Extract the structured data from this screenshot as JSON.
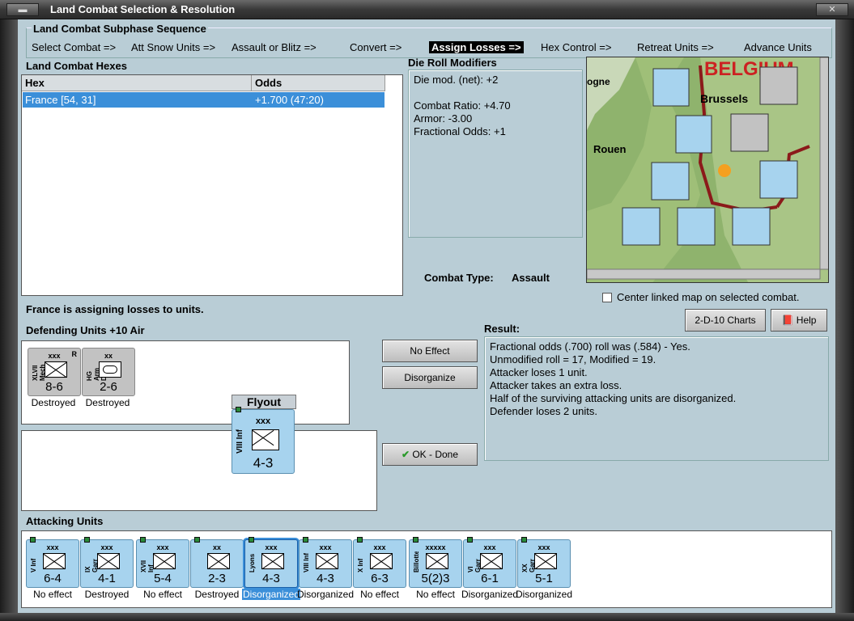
{
  "window": {
    "title": "Land Combat Selection & Resolution"
  },
  "sequence": {
    "legend": "Land Combat Subphase Sequence",
    "steps": [
      {
        "label": "Select Combat =>",
        "active": false
      },
      {
        "label": "Att Snow Units =>",
        "active": false
      },
      {
        "label": "Assault or Blitz =>",
        "active": false
      },
      {
        "label": "Convert =>",
        "active": false
      },
      {
        "label": "Assign Losses =>",
        "active": true
      },
      {
        "label": "Hex Control =>",
        "active": false
      },
      {
        "label": "Retreat Units =>",
        "active": false
      },
      {
        "label": "Advance Units",
        "active": false
      }
    ]
  },
  "hexes": {
    "title": "Land Combat Hexes",
    "columns": [
      "Hex",
      "Odds"
    ],
    "rows": [
      {
        "hex": "France [54, 31]",
        "odds": "+1.700 (47:20)"
      }
    ]
  },
  "modifiers": {
    "title": "Die Roll Modifiers",
    "lines": [
      "Die mod. (net): +2",
      "",
      "Combat Ratio: +4.70",
      "Armor: -3.00",
      "Fractional Odds: +1"
    ]
  },
  "combat_type": {
    "label": "Combat Type:",
    "value": "Assault"
  },
  "map": {
    "labels": [
      "BELGIUM",
      "Brussels",
      "Rouen",
      "ogne"
    ],
    "center_checkbox_label": "Center linked map on selected combat.",
    "center_checked": false
  },
  "status": "France is assigning losses to units.",
  "defending": {
    "title": "Defending Units +10 Air",
    "units": [
      {
        "top": "xxx",
        "side": "XLVII Mech",
        "value": "8-6",
        "reserve": "R",
        "caption": "Destroyed",
        "grey": true
      },
      {
        "top": "xx",
        "side": "HG Arm Div",
        "value": "2-6",
        "reserve": "",
        "caption": "Destroyed",
        "grey": true
      }
    ]
  },
  "flyout": {
    "title": "Flyout",
    "unit": {
      "top": "xxx",
      "side": "VIII Inf",
      "value": "4-3"
    }
  },
  "buttons": {
    "no_effect": "No Effect",
    "disorganize": "Disorganize",
    "ok_done": "OK - Done",
    "charts": "2-D-10 Charts",
    "help": "Help"
  },
  "result": {
    "title": "Result:",
    "lines": [
      "Fractional odds (.700) roll was (.584)  - Yes.",
      "Unmodified roll = 17, Modified = 19.",
      "Attacker loses 1 unit.",
      "Attacker takes an extra loss.",
      "Half of the surviving attacking units are disorganized.",
      "Defender loses 2 units."
    ]
  },
  "attacking": {
    "title": "Attacking Units",
    "units": [
      {
        "top": "xxx",
        "side": "V Inf",
        "value": "6-4",
        "caption": "No effect",
        "selected": false
      },
      {
        "top": "xxx",
        "side": "IX Garr",
        "value": "4-1",
        "caption": "Destroyed",
        "selected": false
      },
      {
        "top": "xxx",
        "side": "XVII Inf",
        "value": "5-4",
        "caption": "No effect",
        "selected": false
      },
      {
        "top": "xx",
        "side": "",
        "value": "2-3",
        "caption": "Destroyed",
        "selected": false
      },
      {
        "top": "xxx",
        "side": "Lyons",
        "value": "4-3",
        "caption": "Disorganized",
        "selected": true
      },
      {
        "top": "xxx",
        "side": "VIII Inf",
        "value": "4-3",
        "caption": "Disorganized",
        "selected": false
      },
      {
        "top": "xxx",
        "side": "X Inf",
        "value": "6-3",
        "caption": "No effect",
        "selected": false
      },
      {
        "top": "xxxxx",
        "side": "Billotte",
        "value": "5(2)3",
        "caption": "No effect",
        "selected": false
      },
      {
        "top": "xxx",
        "side": "VI Garr",
        "value": "6-1",
        "caption": "Disorganized",
        "selected": false
      },
      {
        "top": "xxx",
        "side": "XX Garr",
        "value": "5-1",
        "caption": "Disorganized",
        "selected": false
      }
    ]
  }
}
